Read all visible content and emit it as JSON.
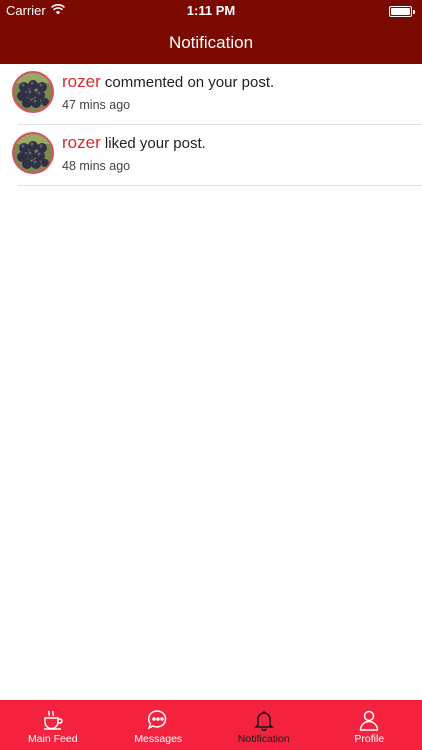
{
  "status_bar": {
    "carrier": "Carrier",
    "time": "1:11 PM",
    "icons": [
      "wifi-icon",
      "battery-icon"
    ]
  },
  "header": {
    "title": "Notification",
    "color": "#7a0a00"
  },
  "notifications": [
    {
      "user": "rozer",
      "action": "commented on your post.",
      "time": "47 mins ago",
      "avatar_icon": "grapes-avatar"
    },
    {
      "user": "rozer",
      "action": "liked your post.",
      "time": "48 mins ago",
      "avatar_icon": "grapes-avatar"
    }
  ],
  "tab_bar": {
    "color": "#f5223f",
    "active_index": 2,
    "tabs": [
      {
        "label": "Main Feed",
        "icon": "coffee-cup-icon"
      },
      {
        "label": "Messages",
        "icon": "chat-bubble-icon"
      },
      {
        "label": "Notification",
        "icon": "bell-icon"
      },
      {
        "label": "Profile",
        "icon": "person-icon"
      }
    ]
  },
  "accent_colors": {
    "username": "#e0262f"
  }
}
